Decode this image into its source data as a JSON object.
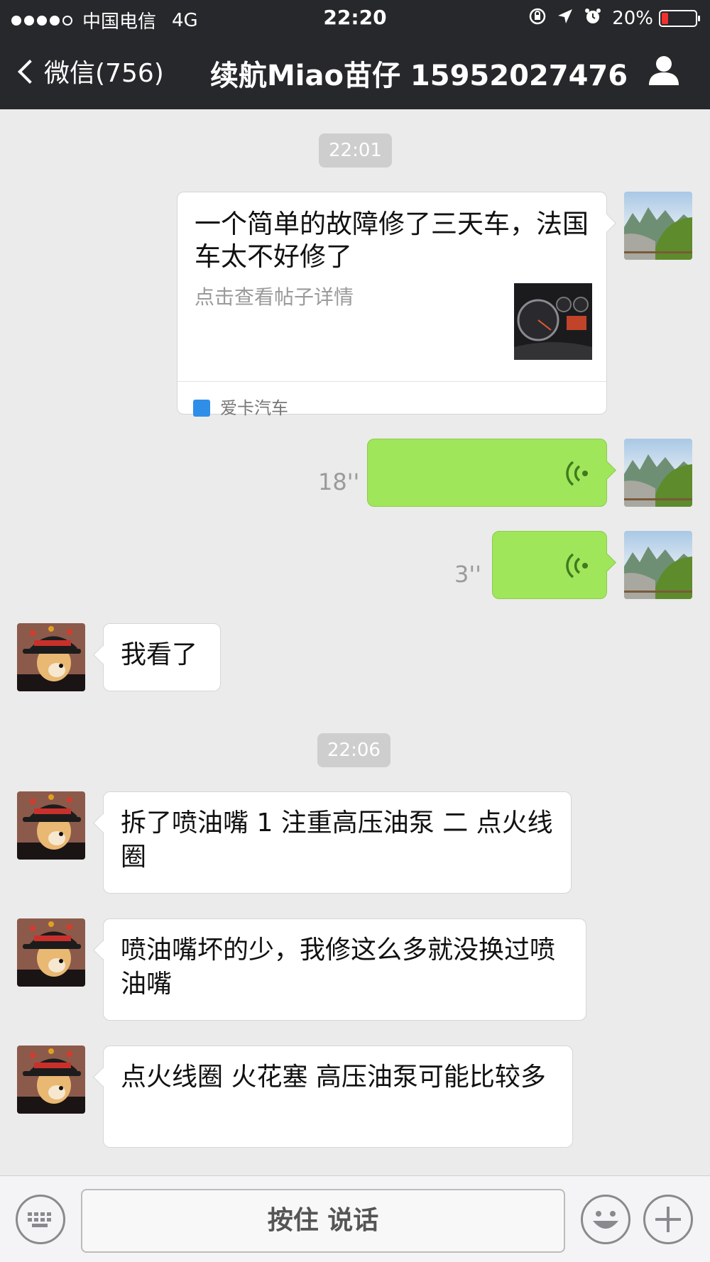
{
  "status_bar": {
    "carrier": "中国电信",
    "network": "4G",
    "time": "22:20",
    "battery_percent": "20%",
    "battery_level": 0.2
  },
  "nav": {
    "back_label": "微信(756)",
    "title": "续航Miao苗仔 15952027476"
  },
  "chat": {
    "timestamps": [
      "22:01",
      "22:06"
    ],
    "link_card": {
      "title": "一个简单的故障修了三天车，法国车太不好修了",
      "description": "点击查看帖子详情",
      "source": "爱卡汽车"
    },
    "voice_messages": [
      {
        "duration": "18''"
      },
      {
        "duration": "3''"
      }
    ],
    "incoming_messages": [
      "我看了",
      "拆了喷油嘴 1 注重高压油泵 二 点火线圈",
      "喷油嘴坏的少，我修这么多就没换过喷油嘴",
      "点火线圈 火花塞 高压油泵可能比较多"
    ]
  },
  "input_bar": {
    "hold_to_talk_label": "按住 说话"
  },
  "colors": {
    "header_bg": "#27282b",
    "chat_bg": "#ebebeb",
    "sent_bubble": "#9fe65a",
    "received_bubble": "#ffffff",
    "battery_low": "#f0312f"
  },
  "icons": [
    "signal-dots-icon",
    "lock-rotation-icon",
    "location-arrow-icon",
    "alarm-icon",
    "battery-icon",
    "back-chevron-icon",
    "profile-icon",
    "voice-wave-icon",
    "keyboard-icon",
    "emoji-icon",
    "plus-icon"
  ]
}
